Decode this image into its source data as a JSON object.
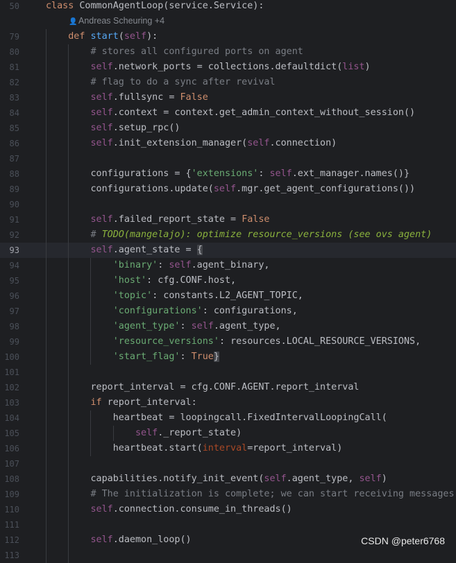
{
  "editor": {
    "blame_author": "Andreas Scheuring +4",
    "lines": [
      {
        "num": "50",
        "html": "<span class='kw'>class</span> CommonAgentLoop(service.Service):"
      },
      {
        "num": "79",
        "html": "    <span class='kw'>def</span> <span class='fn'>start</span>(<span class='self'>self</span>):"
      },
      {
        "num": "80",
        "html": "        <span class='cmt'># stores all configured ports on agent</span>"
      },
      {
        "num": "81",
        "html": "        <span class='self'>self</span>.network_ports = collections.defaultdict(<span class='self'>list</span>)"
      },
      {
        "num": "82",
        "html": "        <span class='cmt'># flag to do a sync after revival</span>"
      },
      {
        "num": "83",
        "html": "        <span class='self'>self</span>.fullsync = <span class='kw'>False</span>"
      },
      {
        "num": "84",
        "html": "        <span class='self'>self</span>.context = context.get_admin_context_without_session()"
      },
      {
        "num": "85",
        "html": "        <span class='self'>self</span>.setup_rpc()"
      },
      {
        "num": "86",
        "html": "        <span class='self'>self</span>.init_extension_manager(<span class='self'>self</span>.connection)"
      },
      {
        "num": "87",
        "html": ""
      },
      {
        "num": "88",
        "html": "        configurations = {<span class='str'>'extensions'</span>: <span class='self'>self</span>.ext_manager.names()}"
      },
      {
        "num": "89",
        "html": "        configurations.update(<span class='self'>self</span>.mgr.get_agent_configurations())"
      },
      {
        "num": "90",
        "html": ""
      },
      {
        "num": "91",
        "html": "        <span class='self'>self</span>.failed_report_state = <span class='kw'>False</span>"
      },
      {
        "num": "92",
        "html": "        <span class='cmt'># </span><span class='todo'>TODO(mangelajo): optimize resource_versions (see ovs agent)</span>"
      },
      {
        "num": "93",
        "html": "        <span class='self'>self</span>.agent_state = <span class='brace'>{</span>",
        "current": true
      },
      {
        "num": "94",
        "html": "            <span class='str'>'binary'</span>: <span class='self'>self</span>.agent_binary,"
      },
      {
        "num": "95",
        "html": "            <span class='str'>'host'</span>: cfg.CONF.host,"
      },
      {
        "num": "96",
        "html": "            <span class='str'>'topic'</span>: constants.L2_AGENT_TOPIC,"
      },
      {
        "num": "97",
        "html": "            <span class='str'>'configurations'</span>: configurations,"
      },
      {
        "num": "98",
        "html": "            <span class='str'>'agent_type'</span>: <span class='self'>self</span>.agent_type,"
      },
      {
        "num": "99",
        "html": "            <span class='str'>'resource_versions'</span>: resources.LOCAL_RESOURCE_VERSIONS,"
      },
      {
        "num": "100",
        "html": "            <span class='str'>'start_flag'</span>: <span class='kw'>True</span><span class='brace'>}</span>"
      },
      {
        "num": "101",
        "html": ""
      },
      {
        "num": "102",
        "html": "        report_interval = cfg.CONF.AGENT.report_interval"
      },
      {
        "num": "103",
        "html": "        <span class='kw'>if</span> report_interval:"
      },
      {
        "num": "104",
        "html": "            heartbeat = loopingcall.FixedIntervalLoopingCall("
      },
      {
        "num": "105",
        "html": "                <span class='self'>self</span>._report_state)"
      },
      {
        "num": "106",
        "html": "            heartbeat.start(<span class='named'>interval</span>=report_interval)"
      },
      {
        "num": "107",
        "html": ""
      },
      {
        "num": "108",
        "html": "        capabilities.notify_init_event(<span class='self'>self</span>.agent_type, <span class='self'>self</span>)"
      },
      {
        "num": "109",
        "html": "        <span class='cmt'># The initialization is complete; we can start receiving messages</span>"
      },
      {
        "num": "110",
        "html": "        <span class='self'>self</span>.connection.consume_in_threads()"
      },
      {
        "num": "111",
        "html": ""
      },
      {
        "num": "112",
        "html": "        <span class='self'>self</span>.daemon_loop()"
      },
      {
        "num": "113",
        "html": ""
      }
    ]
  },
  "watermark": "CSDN @peter6768"
}
